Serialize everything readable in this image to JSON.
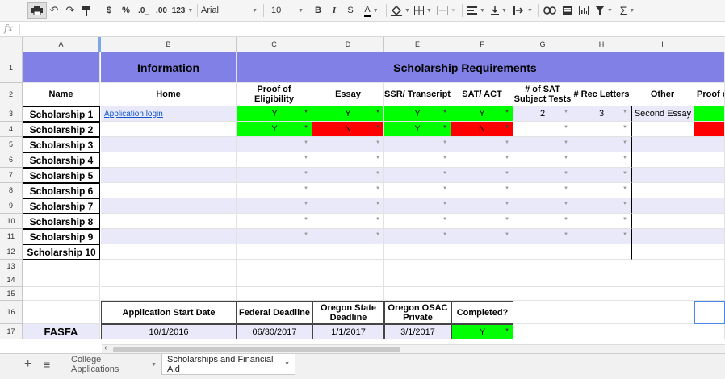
{
  "toolbar": {
    "format_percent": "%",
    "format_decimal_less": ".0_",
    "format_decimal_more": ".00",
    "format_more": "123",
    "currency": "$",
    "font": "Arial",
    "font_size": "10",
    "bold": "B",
    "italic": "I",
    "strike": "S",
    "text_color": "A",
    "functions": "Σ"
  },
  "formula_bar": {
    "fx": "fx"
  },
  "columns": [
    "A",
    "B",
    "C",
    "D",
    "E",
    "F",
    "G",
    "H",
    "I"
  ],
  "rows": [
    "1",
    "2",
    "3",
    "4",
    "5",
    "6",
    "7",
    "8",
    "9",
    "10",
    "11",
    "12",
    "13",
    "14",
    "15",
    "16",
    "17"
  ],
  "sheet": {
    "header1": {
      "information": "Information",
      "requirements": "Scholarship Requirements"
    },
    "header2": {
      "name": "Name",
      "home": "Home",
      "proof": "Proof of Eligibility",
      "essay": "Essay",
      "ssr": "SSR/ Transcript",
      "sat": "SAT/ ACT",
      "sat_subject": "# of SAT Subject Tests",
      "rec": "# Rec Letters",
      "other": "Other",
      "proof_cut": "Proof o"
    },
    "scholarships": [
      "Scholarship 1",
      "Scholarship 2",
      "Scholarship 3",
      "Scholarship 4",
      "Scholarship 5",
      "Scholarship 6",
      "Scholarship 7",
      "Scholarship 8",
      "Scholarship 9",
      "Scholarship 10"
    ],
    "row3": {
      "link": "Application login",
      "proof": "Y",
      "essay": "Y",
      "ssr": "Y",
      "sat": "Y",
      "sat_subject": "2",
      "rec": "3",
      "other": "Second Essay"
    },
    "row4": {
      "proof": "Y",
      "essay": "N",
      "ssr": "Y",
      "sat": "N"
    },
    "row16": {
      "start": "Application Start Date",
      "federal": "Federal Deadline",
      "oregon": "Oregon State Deadline",
      "osac": "Oregon OSAC Private",
      "completed": "Completed?"
    },
    "row17": {
      "name": "FASFA",
      "start": "10/1/2016",
      "federal": "06/30/2017",
      "oregon": "1/1/2017",
      "osac": "3/1/2017",
      "completed": "Y"
    }
  },
  "tabs": {
    "add": "+",
    "list": "≡",
    "tab1": "College Applications",
    "tab2": "Scholarships and Financial Aid"
  },
  "colors": {
    "header_purple": "#8080e6",
    "band": "#e9e9f9",
    "yes": "#00ff00",
    "no": "#ff0000"
  }
}
